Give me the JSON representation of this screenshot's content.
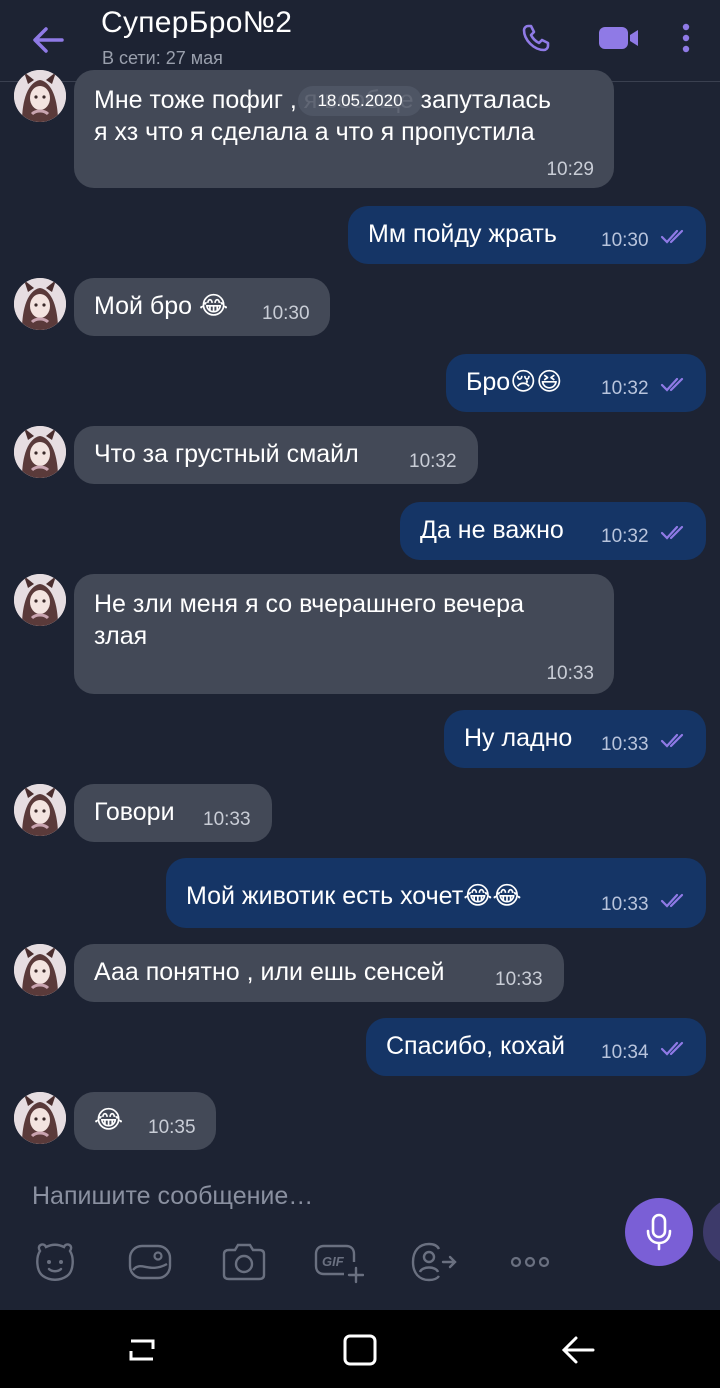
{
  "header": {
    "title": "СуперБро№2",
    "status": "В сети: 27 мая"
  },
  "date_pill": "18.05.2020",
  "messages": [
    {
      "dir": "in",
      "line1": "Мне тоже пофиг , я вообще запуталась",
      "line2": "я хз что я сделала а что я пропустила",
      "time": "10:29"
    },
    {
      "dir": "out",
      "text": "Мм пойду жрать",
      "time": "10:30"
    },
    {
      "dir": "in",
      "text": "Мой бро 😂",
      "time": "10:30"
    },
    {
      "dir": "out",
      "text": "Бро😢😆",
      "time": "10:32"
    },
    {
      "dir": "in",
      "text": "Что за грустный смайл",
      "time": "10:32"
    },
    {
      "dir": "out",
      "text": "Да не важно",
      "time": "10:32"
    },
    {
      "dir": "in",
      "line1": "Не зли меня я со вчерашнего вечера",
      "line2": "злая",
      "time": "10:33"
    },
    {
      "dir": "out",
      "text": "Ну ладно",
      "time": "10:33"
    },
    {
      "dir": "in",
      "text": "Говори",
      "time": "10:33"
    },
    {
      "dir": "out",
      "text": "Мой животик есть хочет😂😂",
      "time": "10:33"
    },
    {
      "dir": "in",
      "text": "Ааа понятно , или ешь сенсей",
      "time": "10:33"
    },
    {
      "dir": "out",
      "text": "Спасибо, кохай",
      "time": "10:34"
    },
    {
      "dir": "in",
      "text": "😂",
      "time": "10:35"
    }
  ],
  "composer": {
    "placeholder": "Напишите сообщение…"
  },
  "icons": {
    "back": "arrow-left-icon",
    "call": "phone-icon",
    "video": "video-camera-icon",
    "more": "more-vertical-icon",
    "mic": "microphone-icon",
    "tools": [
      "sticker-icon",
      "gallery-icon",
      "camera-icon",
      "gif-icon",
      "share-contact-icon",
      "more-horizontal-icon"
    ],
    "nav": [
      "recent-apps-icon",
      "home-icon",
      "back-nav-icon"
    ]
  },
  "colors": {
    "accent": "#7a5fd6",
    "incoming_bubble": "#434957",
    "outgoing_bubble": "#153566",
    "background": "#1d2333"
  }
}
